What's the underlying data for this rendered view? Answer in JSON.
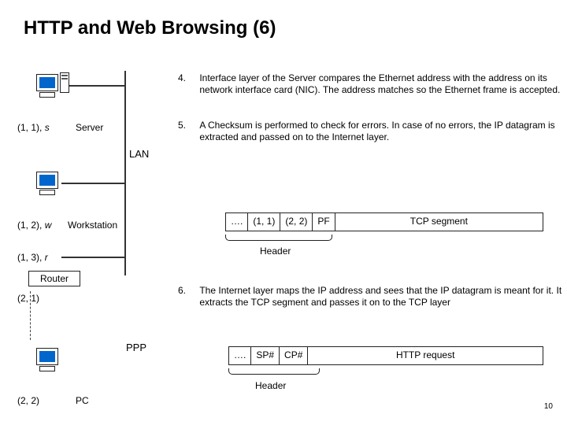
{
  "title": "HTTP and Web Browsing (6)",
  "nodes": {
    "n1": {
      "addr": "(1, 1), ",
      "var": "s",
      "role": "Server"
    },
    "n2": {
      "addr": "(1, 2), ",
      "var": "w",
      "role": "Workstation"
    },
    "n3": {
      "addr": "(1, 3), ",
      "var": "r"
    },
    "router": "Router",
    "n4": {
      "addr": "(2, 1)"
    },
    "n5": {
      "addr": "(2, 2)",
      "role": "PC"
    }
  },
  "lan": "LAN",
  "ppp": "PPP",
  "steps": {
    "a": {
      "num": "4.",
      "text": "Interface layer of the Server compares the Ethernet address with the address on its network interface card (NIC). The address matches so the Ethernet frame is accepted."
    },
    "b": {
      "num": "5.",
      "text": "A Checksum is performed to check for errors. In case of no errors, the IP datagram is extracted and passed on to the Internet layer."
    },
    "c": {
      "num": "6.",
      "text": "The Internet layer maps the IP address and sees that the IP datagram is meant for it. It extracts the TCP segment and passes it on to the TCP layer"
    }
  },
  "seg1": {
    "c0": "….",
    "c1": "(1, 1)",
    "c2": "(2, 2)",
    "c3": "PF",
    "tail": "TCP segment",
    "header": "Header"
  },
  "seg2": {
    "c0": "….",
    "c1": "SP#",
    "c2": "CP#",
    "tail": "HTTP request",
    "header": "Header"
  },
  "page": "10"
}
